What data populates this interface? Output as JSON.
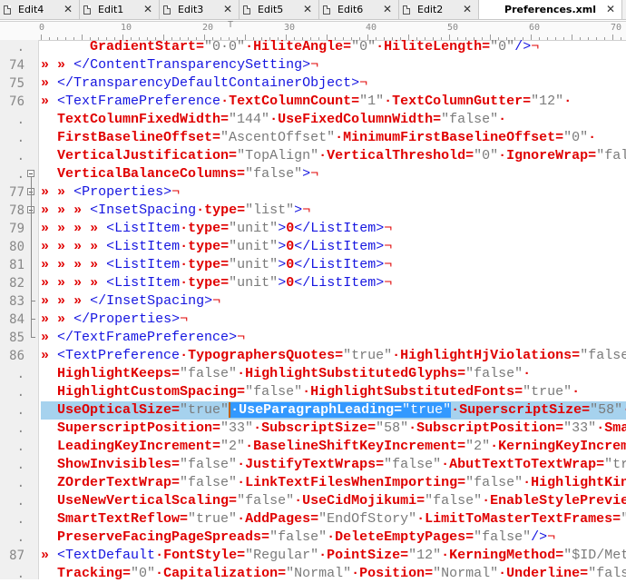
{
  "tabs": [
    {
      "label": "Edit4",
      "active": false
    },
    {
      "label": "Edit1",
      "active": false
    },
    {
      "label": "Edit3",
      "active": false
    },
    {
      "label": "Edit5",
      "active": false
    },
    {
      "label": "Edit6",
      "active": false
    },
    {
      "label": "Edit2",
      "active": false
    },
    {
      "label": "Preferences.xml",
      "active": true
    }
  ],
  "ruler": {
    "labels": [
      "0",
      "10",
      "20",
      "30",
      "40",
      "50",
      "60",
      "70"
    ]
  },
  "colors": {
    "attribute": "#e00000",
    "tag": "#1515e0",
    "value": "#7a7a7a",
    "current_line": "#a6d2ee",
    "selection": "#3399ff"
  },
  "lines": [
    {
      "num": ".",
      "text": "      GradientStart=\"0·0\"·HiliteAngle=\"0\"·HiliteLength=\"0\"/>¬"
    },
    {
      "num": "74",
      "text": "» » </ContentTransparencySetting>¬"
    },
    {
      "num": "75",
      "text": "» </TransparencyDefaultContainerObject>¬"
    },
    {
      "num": "76",
      "text": "» <TextFramePreference·TextColumnCount=\"1\"·TextColumnGutter=\"12\"·"
    },
    {
      "num": ".",
      "text": "  TextColumnFixedWidth=\"144\"·UseFixedColumnWidth=\"false\"·"
    },
    {
      "num": ".",
      "text": "  FirstBaselineOffset=\"AscentOffset\"·MinimumFirstBaselineOffset=\"0\"·"
    },
    {
      "num": ".",
      "text": "  VerticalJustification=\"TopAlign\"·VerticalThreshold=\"0\"·IgnoreWrap=\"fal"
    },
    {
      "num": ".",
      "text": "  VerticalBalanceColumns=\"false\">¬",
      "fold": "open"
    },
    {
      "num": "77",
      "text": "» » <Properties>¬",
      "fold": "open"
    },
    {
      "num": "78",
      "text": "» » » <InsetSpacing·type=\"list\">¬",
      "fold": "open"
    },
    {
      "num": "79",
      "text": "» » » » <ListItem·type=\"unit\">0</ListItem>¬"
    },
    {
      "num": "80",
      "text": "» » » » <ListItem·type=\"unit\">0</ListItem>¬"
    },
    {
      "num": "81",
      "text": "» » » » <ListItem·type=\"unit\">0</ListItem>¬"
    },
    {
      "num": "82",
      "text": "» » » » <ListItem·type=\"unit\">0</ListItem>¬"
    },
    {
      "num": "83",
      "text": "» » » </InsetSpacing>¬",
      "fold": "end"
    },
    {
      "num": "84",
      "text": "» » </Properties>¬",
      "fold": "end"
    },
    {
      "num": "85",
      "text": "» </TextFramePreference>¬",
      "fold": "end"
    },
    {
      "num": "86",
      "text": "» <TextPreference·TypographersQuotes=\"true\"·HighlightHjViolations=\"false"
    },
    {
      "num": ".",
      "text": "  HighlightKeeps=\"false\"·HighlightSubstitutedGlyphs=\"false\"·"
    },
    {
      "num": ".",
      "text": "  HighlightCustomSpacing=\"false\"·HighlightSubstitutedFonts=\"true\"·"
    },
    {
      "num": ".",
      "text": "  UseOpticalSize=\"true\"·UseParagraphLeading=\"true\"·SuperscriptSize=\"58\"·",
      "current": true,
      "selected": "·UseParagraphLeading=\"true\""
    },
    {
      "num": ".",
      "text": "  SuperscriptPosition=\"33\"·SubscriptSize=\"58\"·SubscriptPosition=\"33\"·Sma"
    },
    {
      "num": ".",
      "text": "  LeadingKeyIncrement=\"2\"·BaselineShiftKeyIncrement=\"2\"·KerningKeyIncrem"
    },
    {
      "num": ".",
      "text": "  ShowInvisibles=\"false\"·JustifyTextWraps=\"false\"·AbutTextToTextWrap=\"tr"
    },
    {
      "num": ".",
      "text": "  ZOrderTextWrap=\"false\"·LinkTextFilesWhenImporting=\"false\"·HighlightKin"
    },
    {
      "num": ".",
      "text": "  UseNewVerticalScaling=\"false\"·UseCidMojikumi=\"false\"·EnableStylePrevie"
    },
    {
      "num": ".",
      "text": "  SmartTextReflow=\"true\"·AddPages=\"EndOfStory\"·LimitToMasterTextFrames=\""
    },
    {
      "num": ".",
      "text": "  PreserveFacingPageSpreads=\"false\"·DeleteEmptyPages=\"false\"/>¬"
    },
    {
      "num": "87",
      "text": "» <TextDefault·FontStyle=\"Regular\"·PointSize=\"12\"·KerningMethod=\"$ID/Met"
    },
    {
      "num": ".",
      "text": "  Tracking=\"0\"·Capitalization=\"Normal\"·Position=\"Normal\"·Underline=\"fals"
    }
  ]
}
